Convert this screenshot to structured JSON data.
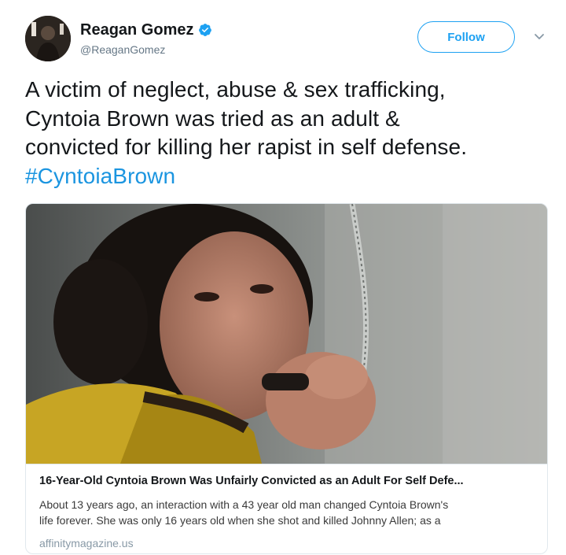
{
  "user": {
    "display_name": "Reagan Gomez",
    "handle": "@ReaganGomez",
    "verified": true
  },
  "actions": {
    "follow_label": "Follow",
    "menu_icon": "chevron-down-icon"
  },
  "tweet": {
    "text_lines": [
      "A victim of neglect, abuse & sex trafficking,",
      "Cyntoia Brown was tried as an adult &",
      "convicted for killing her rapist in self defense."
    ],
    "hashtag": "#CyntoiaBrown"
  },
  "card": {
    "title": "16-Year-Old Cyntoia Brown Was Unfairly Convicted as an Adult For Self Defe...",
    "description_lines": [
      "About 13 years ago, an interaction with a 43 year old man changed Cyntoia Brown's",
      "life forever. She was only 16 years old when she shot and killed Johnny Allen; as a"
    ],
    "domain": "affinitymagazine.us"
  },
  "colors": {
    "accent": "#1da1f2",
    "hashtag": "#1b95e0",
    "secondary_text": "#657786",
    "card_border": "#e1e8ed"
  }
}
